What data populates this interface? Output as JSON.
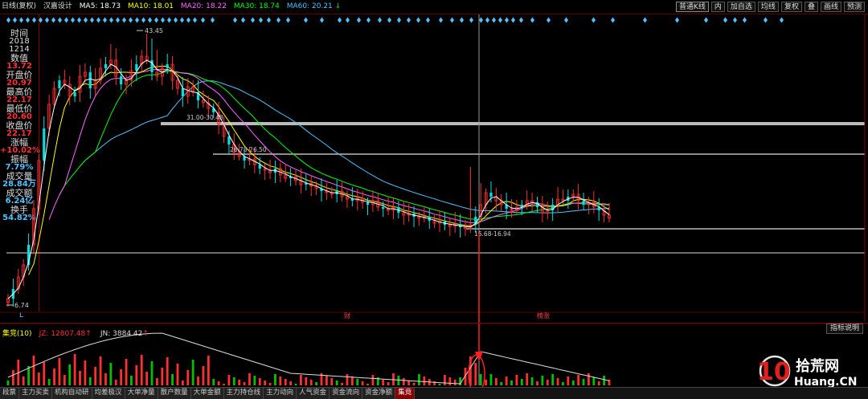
{
  "header": {
    "period_label": "日线(复权)",
    "stock_name": "汉嘉设计",
    "ma5": "MA5: 18.73",
    "ma10": "MA10: 18.01",
    "ma20": "MA20: 18.22",
    "ma30": "MA30: 18.74",
    "ma60": "MA60: 20.21",
    "down_arrow": "↓",
    "ma_colors": {
      "ma5": "#ffffff",
      "ma10": "#ffff00",
      "ma20": "#ff66ff",
      "ma30": "#00ff00",
      "ma60": "#4fc3ff"
    },
    "controls": [
      "普通K线",
      "内",
      "加自选",
      "均线",
      "复权",
      "叠",
      "画线",
      "预测"
    ]
  },
  "info_panel": {
    "time_label": "时间",
    "year": "2018",
    "date": "1214",
    "value_label": "数值",
    "value": "13.72",
    "open_label": "开盘价",
    "open": "20.97",
    "high_label": "最高价",
    "high": "22.17",
    "low_label": "最低价",
    "low": "20.60",
    "close_label": "收盘价",
    "close": "22.17",
    "change_label": "涨幅",
    "change": "+10.02%",
    "amplitude_label": "振幅",
    "amplitude": "7.79%",
    "volume_label": "成交量",
    "volume": "28.84万",
    "amount_label": "成交额",
    "amount": "6.24亿",
    "turnover_label": "换手",
    "turnover": "54.82%",
    "bottom_letter": "L"
  },
  "chart_annotations": {
    "high_price": "43.45",
    "low_price": "6.74",
    "range1": "31.00-30.48",
    "range2": "26.78-26.50",
    "range3": "16.68-16.94",
    "marker_cai": "财",
    "marker_bangdan": "榜涨"
  },
  "sub_indicator": {
    "name": "集竞(10)",
    "jz": "JZ: 12807.48",
    "jz_arrow": "↑",
    "jn": "JN: 3884.42",
    "jn_arrow": "↑",
    "button": "指标说明"
  },
  "tabs": [
    "段票",
    "主力买卖",
    "机构自动研",
    "均差极汉",
    "大单净量",
    "散户数量",
    "大单金额",
    "主力持仓线",
    "主力动向",
    "人气资金",
    "资金流向",
    "资金净额",
    "集竞"
  ],
  "active_tab": "集竞",
  "watermark": {
    "number": "10",
    "cn": "拾荒网",
    "domain": "Huang.CN"
  }
}
